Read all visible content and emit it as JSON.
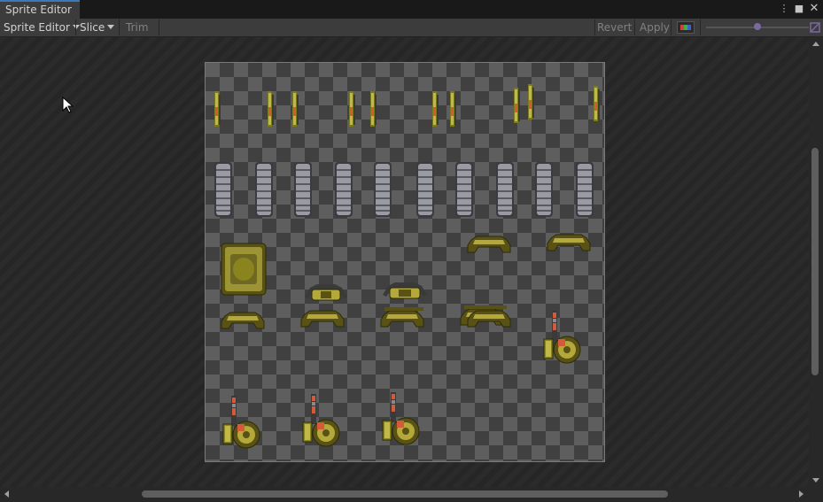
{
  "window": {
    "tab_title": "Sprite Editor",
    "menu_icon": "kebab-menu-icon",
    "maximize_icon": "maximize-icon",
    "close_icon": "close-icon"
  },
  "toolbar": {
    "mode_label": "Sprite Editor",
    "slice_label": "Slice",
    "trim_label": "Trim",
    "revert_label": "Revert",
    "apply_label": "Apply",
    "color_channel_icon": "rgb-channel-icon",
    "zoom_icon": "zoom-icon"
  },
  "colors": {
    "tab_accent": "#3a79bb",
    "sprite_olive": "#a5a23a",
    "sprite_gray": "#8e8e96",
    "sprite_red": "#d45a3a"
  }
}
